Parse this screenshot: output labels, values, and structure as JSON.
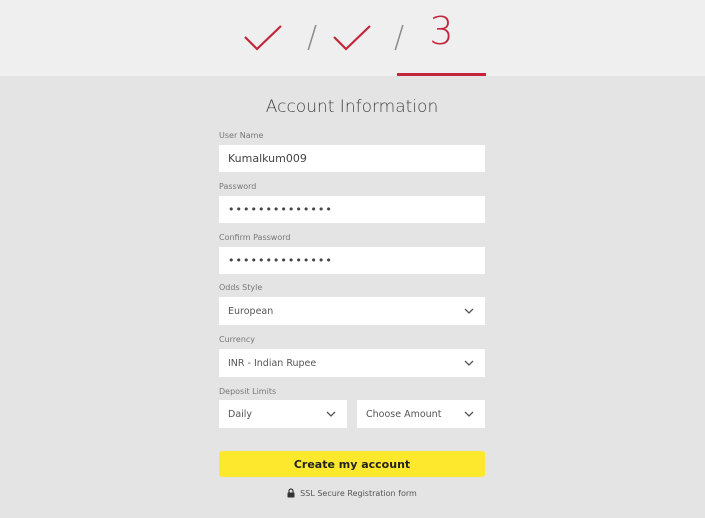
{
  "stepper": {
    "steps": [
      {
        "state": "complete",
        "icon": "checkmark-icon"
      },
      {
        "state": "complete",
        "icon": "checkmark-icon"
      },
      {
        "state": "current",
        "label": "3"
      }
    ],
    "separator": "/",
    "accent_color": "#c1263a"
  },
  "form": {
    "title": "Account Information",
    "username": {
      "label": "User Name",
      "value": "Kumalkum009"
    },
    "password": {
      "label": "Password",
      "value": "••••••••••••••"
    },
    "confirm_password": {
      "label": "Confirm Password",
      "value": "••••••••••••••"
    },
    "odds_style": {
      "label": "Odds Style",
      "value": "European"
    },
    "currency": {
      "label": "Currency",
      "value": "INR - Indian Rupee"
    },
    "deposit_limits": {
      "label": "Deposit Limits",
      "period": {
        "value": "Daily"
      },
      "amount": {
        "value": "Choose Amount"
      }
    },
    "submit_label": "Create my account",
    "ssl_text": "SSL Secure Registration form",
    "submit_color": "#fde82e"
  }
}
